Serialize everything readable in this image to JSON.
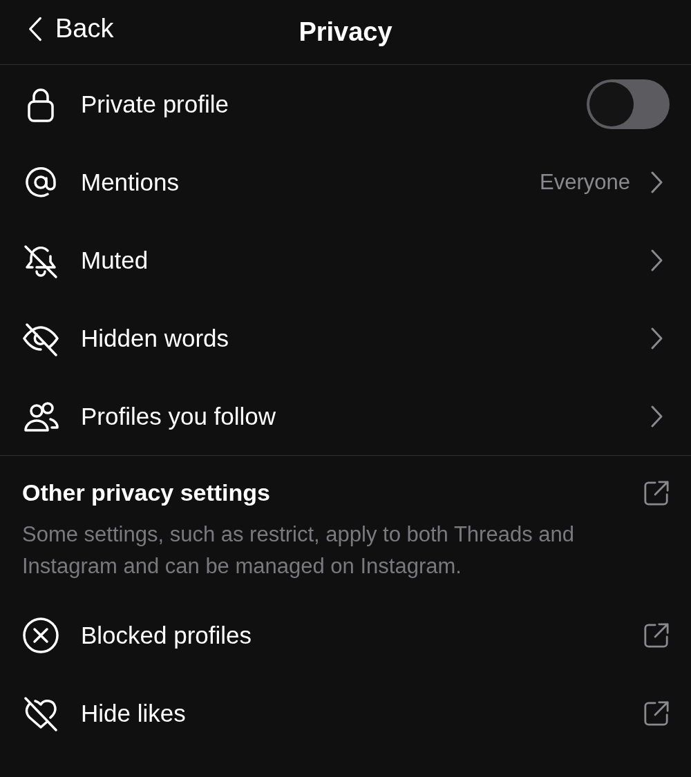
{
  "header": {
    "back": "Back",
    "title": "Privacy"
  },
  "items": [
    {
      "kind": "toggle",
      "label": "Private profile",
      "on": false
    },
    {
      "kind": "link",
      "label": "Mentions",
      "value": "Everyone"
    },
    {
      "kind": "link",
      "label": "Muted"
    },
    {
      "kind": "link",
      "label": "Hidden words"
    },
    {
      "kind": "link",
      "label": "Profiles you follow"
    }
  ],
  "other": {
    "title": "Other privacy settings",
    "description": "Some settings, such as restrict, apply to both Threads and Instagram and can be managed on Instagram.",
    "items": [
      {
        "kind": "external",
        "label": "Blocked profiles"
      },
      {
        "kind": "external",
        "label": "Hide likes"
      }
    ]
  }
}
